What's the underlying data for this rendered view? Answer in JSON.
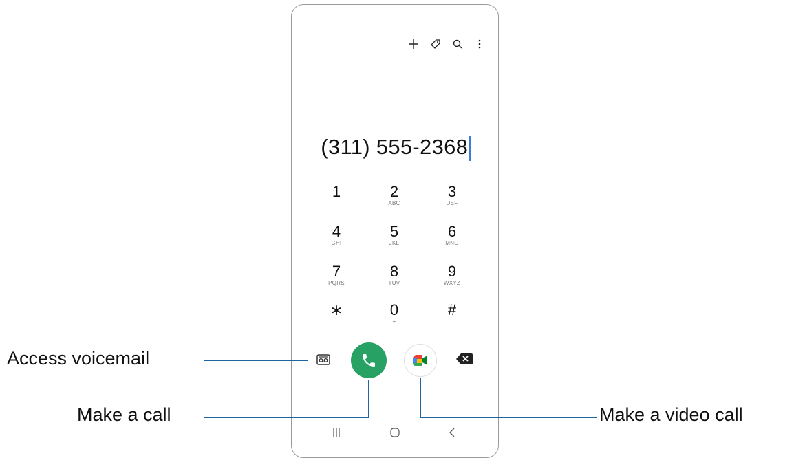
{
  "dialer": {
    "phone_number": "(311) 555-2368",
    "keys": [
      {
        "digit": "1",
        "letters": ""
      },
      {
        "digit": "2",
        "letters": "ABC"
      },
      {
        "digit": "3",
        "letters": "DEF"
      },
      {
        "digit": "4",
        "letters": "GHI"
      },
      {
        "digit": "5",
        "letters": "JKL"
      },
      {
        "digit": "6",
        "letters": "MNO"
      },
      {
        "digit": "7",
        "letters": "PQRS"
      },
      {
        "digit": "8",
        "letters": "TUV"
      },
      {
        "digit": "9",
        "letters": "WXYZ"
      },
      {
        "digit": "∗",
        "letters": ""
      },
      {
        "digit": "0",
        "letters": "+"
      },
      {
        "digit": "#",
        "letters": ""
      }
    ],
    "top_icons": [
      "add-icon",
      "tag-icon",
      "search-icon",
      "more-options-icon"
    ],
    "call_color": "#27a164",
    "caret_color": "#3c7bd6"
  },
  "callouts": {
    "voicemail": "Access voicemail",
    "call": "Make a call",
    "video": "Make a video call",
    "line_color": "#1e64a0"
  },
  "navbar": [
    "recent-apps-icon",
    "home-icon",
    "back-icon"
  ]
}
